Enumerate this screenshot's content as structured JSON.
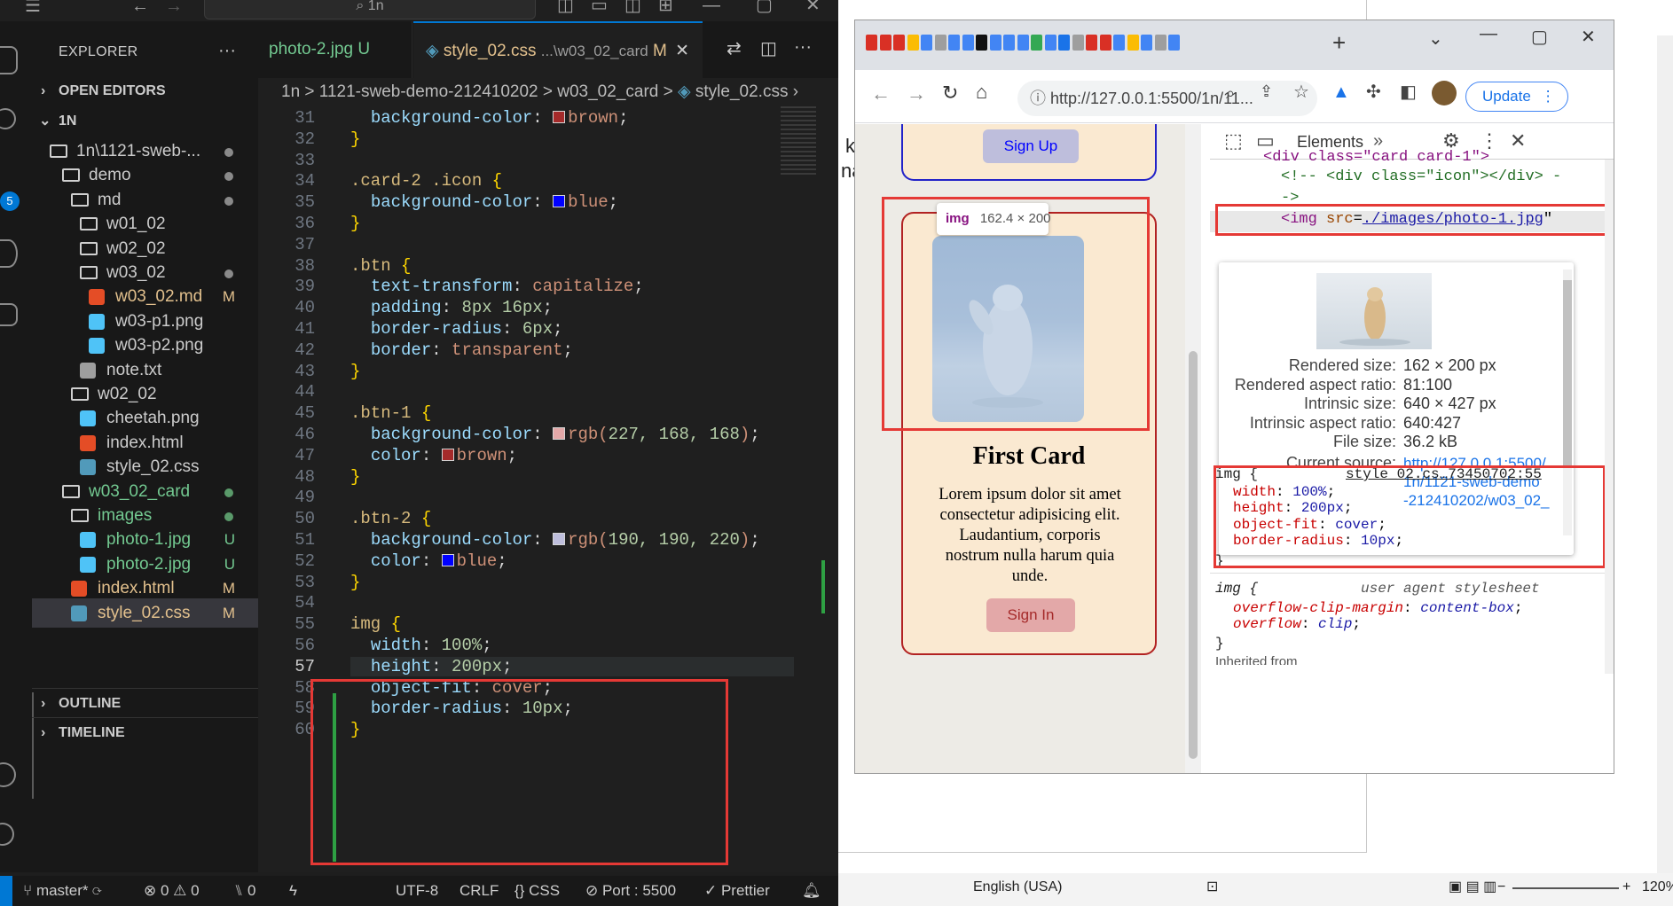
{
  "vscode": {
    "search_text": "1n",
    "explorer_title": "EXPLORER",
    "sections": {
      "open_editors": "OPEN EDITORS",
      "root": "1N",
      "outline": "OUTLINE",
      "timeline": "TIMELINE"
    },
    "tree": [
      {
        "label": "1n\\1121-sweb-...",
        "indent": 14,
        "type": "folder",
        "status": "dot"
      },
      {
        "label": "demo",
        "indent": 28,
        "type": "folder",
        "status": "dot"
      },
      {
        "label": "md",
        "indent": 38,
        "type": "folder",
        "status": "dot"
      },
      {
        "label": "w01_02",
        "indent": 48,
        "type": "folder",
        "status": ""
      },
      {
        "label": "w02_02",
        "indent": 48,
        "type": "folder",
        "status": ""
      },
      {
        "label": "w03_02",
        "indent": 48,
        "type": "folder",
        "status": "dot"
      },
      {
        "label": "w03_02.md",
        "indent": 58,
        "type": "md",
        "status": "M"
      },
      {
        "label": "w03-p1.png",
        "indent": 58,
        "type": "png",
        "status": ""
      },
      {
        "label": "w03-p2.png",
        "indent": 58,
        "type": "png",
        "status": ""
      },
      {
        "label": "note.txt",
        "indent": 48,
        "type": "txt",
        "status": ""
      },
      {
        "label": "w02_02",
        "indent": 38,
        "type": "folder",
        "status": ""
      },
      {
        "label": "cheetah.png",
        "indent": 48,
        "type": "png",
        "status": ""
      },
      {
        "label": "index.html",
        "indent": 48,
        "type": "html",
        "status": ""
      },
      {
        "label": "style_02.css",
        "indent": 48,
        "type": "css",
        "status": ""
      },
      {
        "label": "w03_02_card",
        "indent": 28,
        "type": "folder",
        "status": "dotg"
      },
      {
        "label": "images",
        "indent": 38,
        "type": "folder",
        "status": "dotg"
      },
      {
        "label": "photo-1.jpg",
        "indent": 48,
        "type": "png",
        "status": "U"
      },
      {
        "label": "photo-2.jpg",
        "indent": 48,
        "type": "png",
        "status": "U"
      },
      {
        "label": "index.html",
        "indent": 38,
        "type": "html",
        "status": "M"
      },
      {
        "label": "style_02.css",
        "indent": 38,
        "type": "css",
        "status": "M"
      }
    ],
    "tabs": {
      "tab1": "photo-2.jpg",
      "tab1_status": "U",
      "tab2": "style_02.css",
      "tab2_path": "...\\w03_02_card",
      "tab2_status": "M"
    },
    "breadcrumb": "1n > 1121-sweb-demo-212410202 > w03_02_card >",
    "breadcrumb_file": "style_02.css",
    "code": [
      {
        "n": 31,
        "html": "  <span class='prop'>background-color</span>: <span class='sw' style='background:#a52a2a'></span><span class='val'>brown</span>;"
      },
      {
        "n": 32,
        "html": "<span class='br'>}</span>"
      },
      {
        "n": 33,
        "html": ""
      },
      {
        "n": 34,
        "html": "<span class='sel'>.card-2 .icon</span> <span class='br'>{</span>"
      },
      {
        "n": 35,
        "html": "  <span class='prop'>background-color</span>: <span class='sw' style='background:#0000ff'></span><span class='val'>blue</span>;"
      },
      {
        "n": 36,
        "html": "<span class='br'>}</span>"
      },
      {
        "n": 37,
        "html": ""
      },
      {
        "n": 38,
        "html": "<span class='sel'>.btn</span> <span class='br'>{</span>"
      },
      {
        "n": 39,
        "html": "  <span class='prop'>text-transform</span>: <span class='val'>capitalize</span>;"
      },
      {
        "n": 40,
        "html": "  <span class='prop'>padding</span>: <span class='num'>8px 16px</span>;"
      },
      {
        "n": 41,
        "html": "  <span class='prop'>border-radius</span>: <span class='num'>6px</span>;"
      },
      {
        "n": 42,
        "html": "  <span class='prop'>border</span>: <span class='val'>transparent</span>;"
      },
      {
        "n": 43,
        "html": "<span class='br'>}</span>"
      },
      {
        "n": 44,
        "html": ""
      },
      {
        "n": 45,
        "html": "<span class='sel'>.btn-1</span> <span class='br'>{</span>"
      },
      {
        "n": 46,
        "html": "  <span class='prop'>background-color</span>: <span class='sw' style='background:#e3a8a8'></span><span class='val'>rgb(</span><span class='num'>227, 168, 168</span><span class='val'>)</span>;"
      },
      {
        "n": 47,
        "html": "  <span class='prop'>color</span>: <span class='sw' style='background:#a52a2a'></span><span class='val'>brown</span>;"
      },
      {
        "n": 48,
        "html": "<span class='br'>}</span>"
      },
      {
        "n": 49,
        "html": ""
      },
      {
        "n": 50,
        "html": "<span class='sel'>.btn-2</span> <span class='br'>{</span>"
      },
      {
        "n": 51,
        "html": "  <span class='prop'>background-color</span>: <span class='sw' style='background:#bebedc'></span><span class='val'>rgb(</span><span class='num'>190, 190, 220</span><span class='val'>)</span>;"
      },
      {
        "n": 52,
        "html": "  <span class='prop'>color</span>: <span class='sw' style='background:#0000ff'></span><span class='val'>blue</span>;"
      },
      {
        "n": 53,
        "html": "<span class='br'>}</span>"
      },
      {
        "n": 54,
        "html": ""
      },
      {
        "n": 55,
        "html": "<span class='sel'>img</span> <span class='br'>{</span>"
      },
      {
        "n": 56,
        "html": "  <span class='prop'>width</span>: <span class='num'>100%</span>;"
      },
      {
        "n": 57,
        "html": "  <span class='prop'>height</span>: <span class='num'>200px</span>;"
      },
      {
        "n": 58,
        "html": "  <span class='prop'>object-fit</span>: <span class='val'>cover</span>;"
      },
      {
        "n": 59,
        "html": "  <span class='prop'>border-radius</span>: <span class='num'>10px</span>;"
      },
      {
        "n": 60,
        "html": "<span class='br'>}</span>"
      }
    ],
    "status": {
      "branch": "master*",
      "errors": "0",
      "warnings": "0",
      "ports": "0",
      "encoding": "UTF-8",
      "eol": "CRLF",
      "lang": "CSS",
      "port": "Port : 5500",
      "prettier": "Prettier"
    }
  },
  "chrome": {
    "url": "http://127.0.0.1:5500/1n/11...",
    "update": "Update",
    "page": {
      "signup": "Sign Up",
      "card_title": "First Card",
      "card_text": "Lorem ipsum dolor sit amet consectetur adipisicing elit. Laudantium, corporis nostrum nulla harum quia unde.",
      "signin": "Sign In",
      "img_tag": "img",
      "img_size": "162.4 × 200"
    },
    "devtools": {
      "tab": "Elements",
      "line1": "<div class=\"card card-1\">",
      "line2": "<!-- <div class=\"icon\"></div> -",
      "line3": "->",
      "img_src": "./images/photo-1.jpg",
      "tooltip": [
        {
          "k": "Rendered size:",
          "v": "162 × 200 px"
        },
        {
          "k": "Rendered aspect ratio:",
          "v": "81:100"
        },
        {
          "k": "Intrinsic size:",
          "v": "640 × 427 px"
        },
        {
          "k": "Intrinsic aspect ratio:",
          "v": "640:427"
        },
        {
          "k": "File size:",
          "v": "36.2 kB"
        }
      ],
      "current_source_label": "Current source:",
      "current_source": [
        "http://127.0.0.1:5500/",
        "1n/1121-sweb-demo",
        "-212410202/w03_02_"
      ],
      "rule1_selector": "img {",
      "rule1_source": "style_02.cs…73450702:55",
      "rule1": [
        {
          "p": "width",
          "v": "100%"
        },
        {
          "p": "height",
          "v": "200px"
        },
        {
          "p": "object-fit",
          "v": "cover"
        },
        {
          "p": "border-radius",
          "v": "10px"
        }
      ],
      "rule2_selector": "img {",
      "rule2_source": "user agent stylesheet",
      "rule2": [
        {
          "p": "overflow-clip-margin",
          "v": "content-box"
        },
        {
          "p": "overflow",
          "v": "clip"
        }
      ],
      "inherited": "Inherited from"
    }
  },
  "word": {
    "lang": "English (USA)",
    "zoom": "120%",
    "left_chars_1": "k",
    "left_chars_2": "na"
  }
}
